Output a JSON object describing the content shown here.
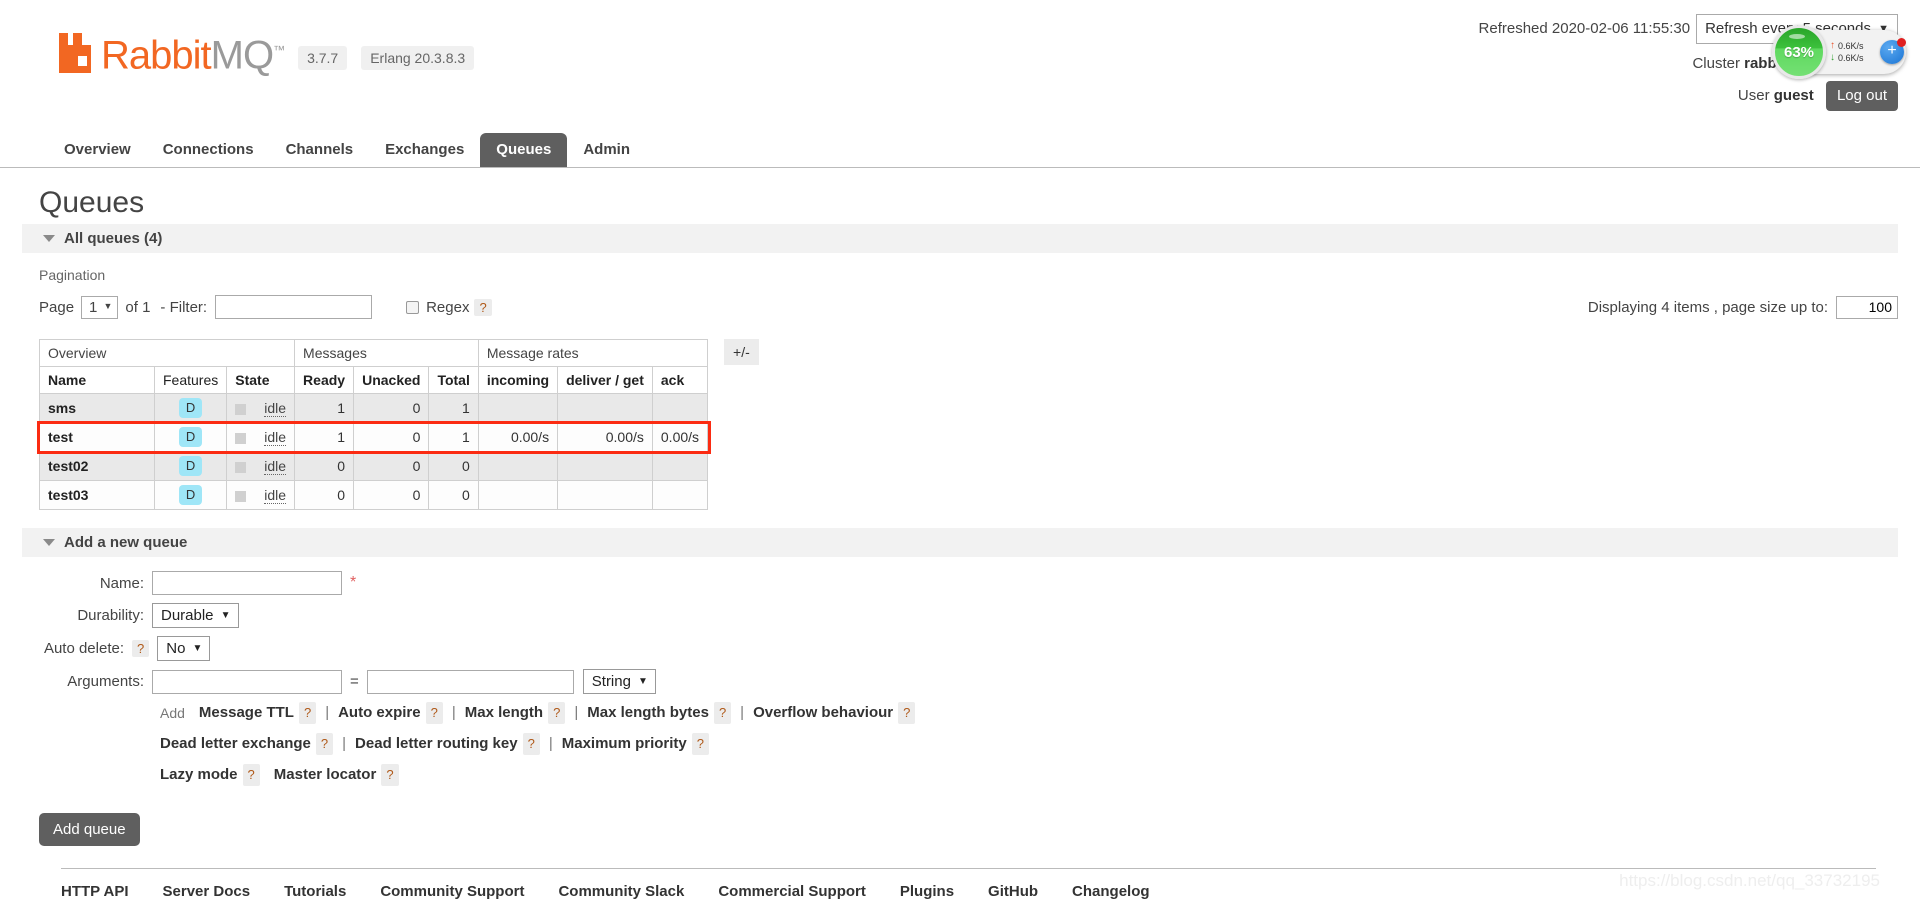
{
  "header": {
    "logo_rabbit": "Rabbit",
    "logo_mq": "MQ",
    "logo_tm": "™",
    "version": "3.7.7",
    "erlang": "Erlang 20.3.8.3",
    "refreshed_label": "Refreshed 2020-02-06 11:55:30",
    "refresh_select": "Refresh every 5 seconds",
    "cluster_label": "Cluster",
    "cluster_name": "rabbit@b59cf94a10e2",
    "user_label": "User",
    "user_name": "guest",
    "logout": "Log out"
  },
  "speed_widget": {
    "percent": "63%",
    "upload": "0.6K/s",
    "download": "0.6K/s",
    "add": "+",
    "up_arrow": "↑",
    "down_arrow": "↓"
  },
  "nav": {
    "tabs": [
      {
        "label": "Overview",
        "active": false
      },
      {
        "label": "Connections",
        "active": false
      },
      {
        "label": "Channels",
        "active": false
      },
      {
        "label": "Exchanges",
        "active": false
      },
      {
        "label": "Queues",
        "active": true
      },
      {
        "label": "Admin",
        "active": false
      }
    ]
  },
  "page": {
    "title": "Queues",
    "all_queues_header": "All queues (4)",
    "pagination_label": "Pagination"
  },
  "pagination": {
    "page_word": "Page",
    "page_value": "1",
    "of_text": "of 1",
    "filter_label": "- Filter:",
    "filter_value": "",
    "regex_label": "Regex",
    "help": "?",
    "displaying_text": "Displaying 4 items , page size up to:",
    "page_size": "100"
  },
  "table": {
    "group_headers": [
      "Overview",
      "Messages",
      "Message rates"
    ],
    "columns": [
      "Name",
      "Features",
      "State",
      "Ready",
      "Unacked",
      "Total",
      "incoming",
      "deliver / get",
      "ack"
    ],
    "plusminus": "+/-",
    "durability_badge": "D",
    "rows": [
      {
        "name": "sms",
        "features": "D",
        "state": "idle",
        "ready": "1",
        "unacked": "0",
        "total": "1",
        "incoming": "",
        "deliver": "",
        "ack": "",
        "highlighted": false
      },
      {
        "name": "test",
        "features": "D",
        "state": "idle",
        "ready": "1",
        "unacked": "0",
        "total": "1",
        "incoming": "0.00/s",
        "deliver": "0.00/s",
        "ack": "0.00/s",
        "highlighted": true
      },
      {
        "name": "test02",
        "features": "D",
        "state": "idle",
        "ready": "0",
        "unacked": "0",
        "total": "0",
        "incoming": "",
        "deliver": "",
        "ack": "",
        "highlighted": false
      },
      {
        "name": "test03",
        "features": "D",
        "state": "idle",
        "ready": "0",
        "unacked": "0",
        "total": "0",
        "incoming": "",
        "deliver": "",
        "ack": "",
        "highlighted": false
      }
    ]
  },
  "add_queue": {
    "section_title": "Add a new queue",
    "name_label": "Name:",
    "name_value": "",
    "required_star": "*",
    "durability_label": "Durability:",
    "durability_value": "Durable",
    "autodelete_label": "Auto delete:",
    "autodelete_value": "No",
    "arguments_label": "Arguments:",
    "arg_key": "",
    "arg_value": "",
    "arg_type": "String",
    "equals": "=",
    "add_word": "Add",
    "preset_rows": [
      [
        "Message TTL",
        "Auto expire",
        "Max length",
        "Max length bytes",
        "Overflow behaviour"
      ],
      [
        "Dead letter exchange",
        "Dead letter routing key",
        "Maximum priority"
      ],
      [
        "Lazy mode",
        "Master locator"
      ]
    ],
    "submit": "Add queue"
  },
  "footer": {
    "links": [
      "HTTP API",
      "Server Docs",
      "Tutorials",
      "Community Support",
      "Community Slack",
      "Commercial Support",
      "Plugins",
      "GitHub",
      "Changelog"
    ]
  },
  "watermark": "https://blog.csdn.net/qq_33732195",
  "colors": {
    "brand_orange": "#f26722",
    "active_tab": "#5f5f5f",
    "durable_badge": "#9fe6f7",
    "highlight_border": "#fb2b12"
  }
}
